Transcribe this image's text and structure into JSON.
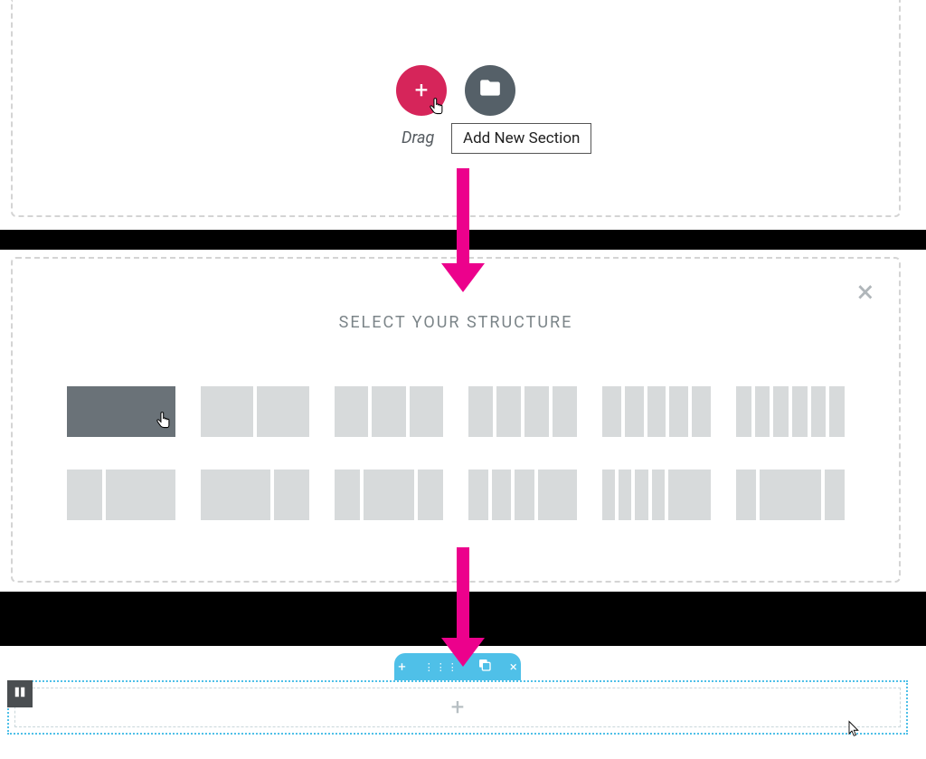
{
  "panel1": {
    "drag_label": "Drag",
    "tooltip": "Add New Section"
  },
  "structure": {
    "title": "SELECT YOUR STRUCTURE",
    "options": [
      {
        "cells": [
          1
        ],
        "active": true
      },
      {
        "cells": [
          1,
          1
        ]
      },
      {
        "cells": [
          1,
          1,
          1
        ]
      },
      {
        "cells": [
          1,
          1,
          1,
          1
        ]
      },
      {
        "cells": [
          1,
          1,
          1,
          1,
          1
        ]
      },
      {
        "cells": [
          1,
          1,
          1,
          1,
          1,
          1
        ]
      },
      {
        "cells": [
          1,
          2
        ]
      },
      {
        "cells": [
          2,
          1
        ]
      },
      {
        "cells": [
          1,
          2,
          1
        ]
      },
      {
        "cells": [
          1,
          1,
          1,
          2
        ]
      },
      {
        "cells": [
          0.5,
          0.5,
          0.5,
          0.5,
          2
        ]
      },
      {
        "cells": [
          1,
          3,
          1
        ]
      }
    ]
  },
  "toolbar": {
    "items": [
      "plus-icon",
      "drag-dots-icon",
      "overlap-icon",
      "close-icon"
    ]
  },
  "colors": {
    "brand_pink": "#d6255a",
    "arrow_pink": "#ec018c",
    "folder_gray": "#556068",
    "elementor_blue": "#4fc0e8",
    "cell_gray": "#d7dadb",
    "cell_active": "#6a7278"
  }
}
